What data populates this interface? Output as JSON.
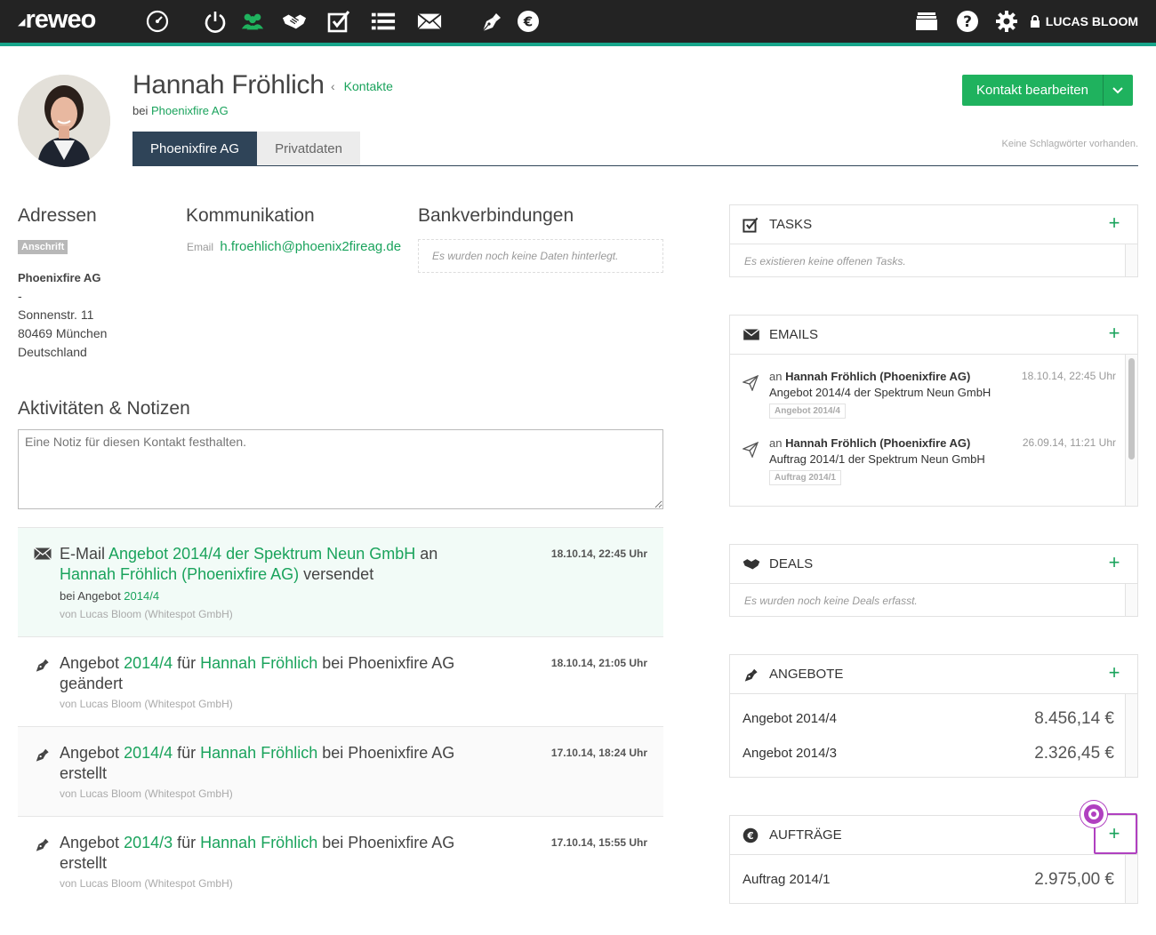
{
  "app": {
    "logo": "reweo",
    "user_name": "LUCAS BLOOM"
  },
  "nav": {
    "icons": [
      "dashboard-icon",
      "power-icon",
      "contacts-icon",
      "handshake-icon",
      "tasks-icon",
      "list-icon",
      "mail-icon",
      "quote-pen-icon",
      "euro-icon",
      "archive-icon",
      "help-icon",
      "settings-icon",
      "lock-icon"
    ],
    "active": "contacts-icon",
    "accent": "#17a58a"
  },
  "contact": {
    "name": "Hannah Fröhlich",
    "breadcrumb": "Kontakte",
    "at_prefix": "bei",
    "company": "Phoenixfire AG",
    "edit_button": "Kontakt bearbeiten",
    "no_tags": "Keine Schlagwörter vorhanden."
  },
  "tabs": [
    {
      "label": "Phoenixfire AG",
      "active": true
    },
    {
      "label": "Privatdaten",
      "active": false
    }
  ],
  "addresses": {
    "heading": "Adressen",
    "badge": "Anschrift",
    "company": "Phoenixfire AG",
    "dash": "-",
    "street": "Sonnenstr. 11",
    "city": "80469 München",
    "country": "Deutschland"
  },
  "communication": {
    "heading": "Kommunikation",
    "email_label": "Email",
    "email": "h.froehlich@phoenix2fireag.de"
  },
  "bank": {
    "heading": "Bankverbindungen",
    "empty": "Es wurden noch keine Daten hinterlegt."
  },
  "activities": {
    "heading": "Aktivitäten & Notizen",
    "note_placeholder": "Eine Notiz für diesen Kontakt festhalten.",
    "items": [
      {
        "icon": "mail-icon",
        "p1": "E-Mail ",
        "l1": "Angebot 2014/4 der Spektrum Neun GmbH",
        "p2": " an ",
        "l2": "Hannah Fröhlich (Phoenixfire AG)",
        "p3": " versendet",
        "date": "18.10.14, 22:45 Uhr",
        "sub_prefix": "bei Angebot ",
        "sub_link": "2014/4",
        "by": "von Lucas Bloom (Whitespot GmbH)"
      },
      {
        "icon": "quote-pen-icon",
        "p1": "Angebot ",
        "l1": "2014/4",
        "p2": " für ",
        "l2": "Hannah Fröhlich",
        "p3": " bei Phoenixfire AG geändert",
        "date": "18.10.14, 21:05 Uhr",
        "by": "von Lucas Bloom (Whitespot GmbH)"
      },
      {
        "icon": "quote-pen-icon",
        "p1": "Angebot ",
        "l1": "2014/4",
        "p2": " für ",
        "l2": "Hannah Fröhlich",
        "p3": " bei Phoenixfire AG erstellt",
        "date": "17.10.14, 18:24 Uhr",
        "by": "von Lucas Bloom (Whitespot GmbH)"
      },
      {
        "icon": "quote-pen-icon",
        "p1": "Angebot ",
        "l1": "2014/3",
        "p2": " für ",
        "l2": "Hannah Fröhlich",
        "p3": " bei Phoenixfire AG erstellt",
        "date": "17.10.14, 15:55 Uhr",
        "by": "von Lucas Bloom (Whitespot GmbH)"
      }
    ]
  },
  "panels": {
    "tasks": {
      "title": "TASKS",
      "empty": "Es existieren keine offenen Tasks."
    },
    "emails": {
      "title": "EMAILS",
      "items": [
        {
          "to_prefix": "an",
          "to": "Hannah Fröhlich (Phoenixfire AG)",
          "subject": "Angebot 2014/4 der Spektrum Neun GmbH",
          "tag": "Angebot 2014/4",
          "date": "18.10.14, 22:45 Uhr"
        },
        {
          "to_prefix": "an",
          "to": "Hannah Fröhlich (Phoenixfire AG)",
          "subject": "Auftrag 2014/1 der Spektrum Neun GmbH",
          "tag": "Auftrag 2014/1",
          "date": "26.09.14, 11:21 Uhr"
        }
      ]
    },
    "deals": {
      "title": "DEALS",
      "empty": "Es wurden noch keine Deals erfasst."
    },
    "quotes": {
      "title": "ANGEBOTE",
      "items": [
        {
          "name": "Angebot 2014/4",
          "amount": "8.456,14 €"
        },
        {
          "name": "Angebot 2014/3",
          "amount": "2.326,45 €"
        }
      ]
    },
    "orders": {
      "title": "AUFTRÄGE",
      "items": [
        {
          "name": "Auftrag 2014/1",
          "amount": "2.975,00 €"
        }
      ]
    },
    "add_symbol": "+"
  }
}
